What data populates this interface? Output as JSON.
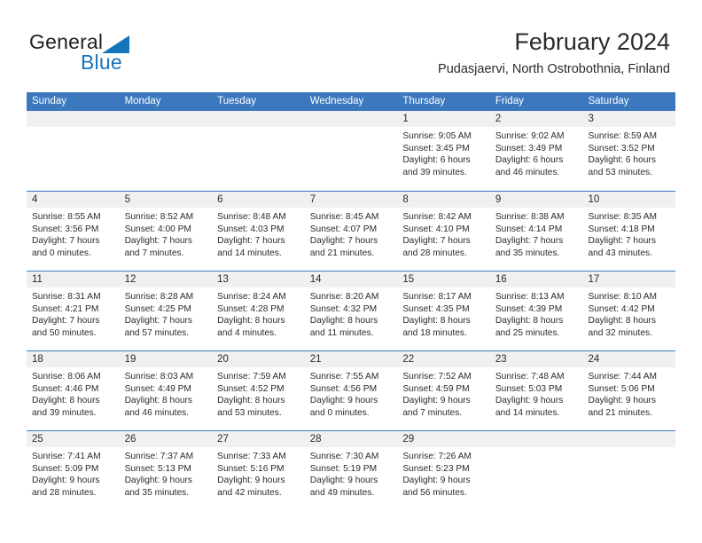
{
  "brand": {
    "name_part1": "General",
    "name_part2": "Blue",
    "triangle_icon": "triangle-icon"
  },
  "header": {
    "title": "February 2024",
    "subtitle": "Pudasjaervi, North Ostrobothnia, Finland"
  },
  "colors": {
    "header_blue": "#3b78bd",
    "brand_blue": "#1b75bb",
    "day_band_gray": "#f0f0f0",
    "text": "#2b2b2b"
  },
  "calendar": {
    "weekday_headers": [
      "Sunday",
      "Monday",
      "Tuesday",
      "Wednesday",
      "Thursday",
      "Friday",
      "Saturday"
    ],
    "weeks": [
      [
        {
          "day": "",
          "empty": true
        },
        {
          "day": "",
          "empty": true
        },
        {
          "day": "",
          "empty": true
        },
        {
          "day": "",
          "empty": true
        },
        {
          "day": "1",
          "sunrise": "Sunrise: 9:05 AM",
          "sunset": "Sunset: 3:45 PM",
          "daylight1": "Daylight: 6 hours",
          "daylight2": "and 39 minutes."
        },
        {
          "day": "2",
          "sunrise": "Sunrise: 9:02 AM",
          "sunset": "Sunset: 3:49 PM",
          "daylight1": "Daylight: 6 hours",
          "daylight2": "and 46 minutes."
        },
        {
          "day": "3",
          "sunrise": "Sunrise: 8:59 AM",
          "sunset": "Sunset: 3:52 PM",
          "daylight1": "Daylight: 6 hours",
          "daylight2": "and 53 minutes."
        }
      ],
      [
        {
          "day": "4",
          "sunrise": "Sunrise: 8:55 AM",
          "sunset": "Sunset: 3:56 PM",
          "daylight1": "Daylight: 7 hours",
          "daylight2": "and 0 minutes."
        },
        {
          "day": "5",
          "sunrise": "Sunrise: 8:52 AM",
          "sunset": "Sunset: 4:00 PM",
          "daylight1": "Daylight: 7 hours",
          "daylight2": "and 7 minutes."
        },
        {
          "day": "6",
          "sunrise": "Sunrise: 8:48 AM",
          "sunset": "Sunset: 4:03 PM",
          "daylight1": "Daylight: 7 hours",
          "daylight2": "and 14 minutes."
        },
        {
          "day": "7",
          "sunrise": "Sunrise: 8:45 AM",
          "sunset": "Sunset: 4:07 PM",
          "daylight1": "Daylight: 7 hours",
          "daylight2": "and 21 minutes."
        },
        {
          "day": "8",
          "sunrise": "Sunrise: 8:42 AM",
          "sunset": "Sunset: 4:10 PM",
          "daylight1": "Daylight: 7 hours",
          "daylight2": "and 28 minutes."
        },
        {
          "day": "9",
          "sunrise": "Sunrise: 8:38 AM",
          "sunset": "Sunset: 4:14 PM",
          "daylight1": "Daylight: 7 hours",
          "daylight2": "and 35 minutes."
        },
        {
          "day": "10",
          "sunrise": "Sunrise: 8:35 AM",
          "sunset": "Sunset: 4:18 PM",
          "daylight1": "Daylight: 7 hours",
          "daylight2": "and 43 minutes."
        }
      ],
      [
        {
          "day": "11",
          "sunrise": "Sunrise: 8:31 AM",
          "sunset": "Sunset: 4:21 PM",
          "daylight1": "Daylight: 7 hours",
          "daylight2": "and 50 minutes."
        },
        {
          "day": "12",
          "sunrise": "Sunrise: 8:28 AM",
          "sunset": "Sunset: 4:25 PM",
          "daylight1": "Daylight: 7 hours",
          "daylight2": "and 57 minutes."
        },
        {
          "day": "13",
          "sunrise": "Sunrise: 8:24 AM",
          "sunset": "Sunset: 4:28 PM",
          "daylight1": "Daylight: 8 hours",
          "daylight2": "and 4 minutes."
        },
        {
          "day": "14",
          "sunrise": "Sunrise: 8:20 AM",
          "sunset": "Sunset: 4:32 PM",
          "daylight1": "Daylight: 8 hours",
          "daylight2": "and 11 minutes."
        },
        {
          "day": "15",
          "sunrise": "Sunrise: 8:17 AM",
          "sunset": "Sunset: 4:35 PM",
          "daylight1": "Daylight: 8 hours",
          "daylight2": "and 18 minutes."
        },
        {
          "day": "16",
          "sunrise": "Sunrise: 8:13 AM",
          "sunset": "Sunset: 4:39 PM",
          "daylight1": "Daylight: 8 hours",
          "daylight2": "and 25 minutes."
        },
        {
          "day": "17",
          "sunrise": "Sunrise: 8:10 AM",
          "sunset": "Sunset: 4:42 PM",
          "daylight1": "Daylight: 8 hours",
          "daylight2": "and 32 minutes."
        }
      ],
      [
        {
          "day": "18",
          "sunrise": "Sunrise: 8:06 AM",
          "sunset": "Sunset: 4:46 PM",
          "daylight1": "Daylight: 8 hours",
          "daylight2": "and 39 minutes."
        },
        {
          "day": "19",
          "sunrise": "Sunrise: 8:03 AM",
          "sunset": "Sunset: 4:49 PM",
          "daylight1": "Daylight: 8 hours",
          "daylight2": "and 46 minutes."
        },
        {
          "day": "20",
          "sunrise": "Sunrise: 7:59 AM",
          "sunset": "Sunset: 4:52 PM",
          "daylight1": "Daylight: 8 hours",
          "daylight2": "and 53 minutes."
        },
        {
          "day": "21",
          "sunrise": "Sunrise: 7:55 AM",
          "sunset": "Sunset: 4:56 PM",
          "daylight1": "Daylight: 9 hours",
          "daylight2": "and 0 minutes."
        },
        {
          "day": "22",
          "sunrise": "Sunrise: 7:52 AM",
          "sunset": "Sunset: 4:59 PM",
          "daylight1": "Daylight: 9 hours",
          "daylight2": "and 7 minutes."
        },
        {
          "day": "23",
          "sunrise": "Sunrise: 7:48 AM",
          "sunset": "Sunset: 5:03 PM",
          "daylight1": "Daylight: 9 hours",
          "daylight2": "and 14 minutes."
        },
        {
          "day": "24",
          "sunrise": "Sunrise: 7:44 AM",
          "sunset": "Sunset: 5:06 PM",
          "daylight1": "Daylight: 9 hours",
          "daylight2": "and 21 minutes."
        }
      ],
      [
        {
          "day": "25",
          "sunrise": "Sunrise: 7:41 AM",
          "sunset": "Sunset: 5:09 PM",
          "daylight1": "Daylight: 9 hours",
          "daylight2": "and 28 minutes."
        },
        {
          "day": "26",
          "sunrise": "Sunrise: 7:37 AM",
          "sunset": "Sunset: 5:13 PM",
          "daylight1": "Daylight: 9 hours",
          "daylight2": "and 35 minutes."
        },
        {
          "day": "27",
          "sunrise": "Sunrise: 7:33 AM",
          "sunset": "Sunset: 5:16 PM",
          "daylight1": "Daylight: 9 hours",
          "daylight2": "and 42 minutes."
        },
        {
          "day": "28",
          "sunrise": "Sunrise: 7:30 AM",
          "sunset": "Sunset: 5:19 PM",
          "daylight1": "Daylight: 9 hours",
          "daylight2": "and 49 minutes."
        },
        {
          "day": "29",
          "sunrise": "Sunrise: 7:26 AM",
          "sunset": "Sunset: 5:23 PM",
          "daylight1": "Daylight: 9 hours",
          "daylight2": "and 56 minutes."
        },
        {
          "day": "",
          "empty": true
        },
        {
          "day": "",
          "empty": true
        }
      ]
    ]
  }
}
